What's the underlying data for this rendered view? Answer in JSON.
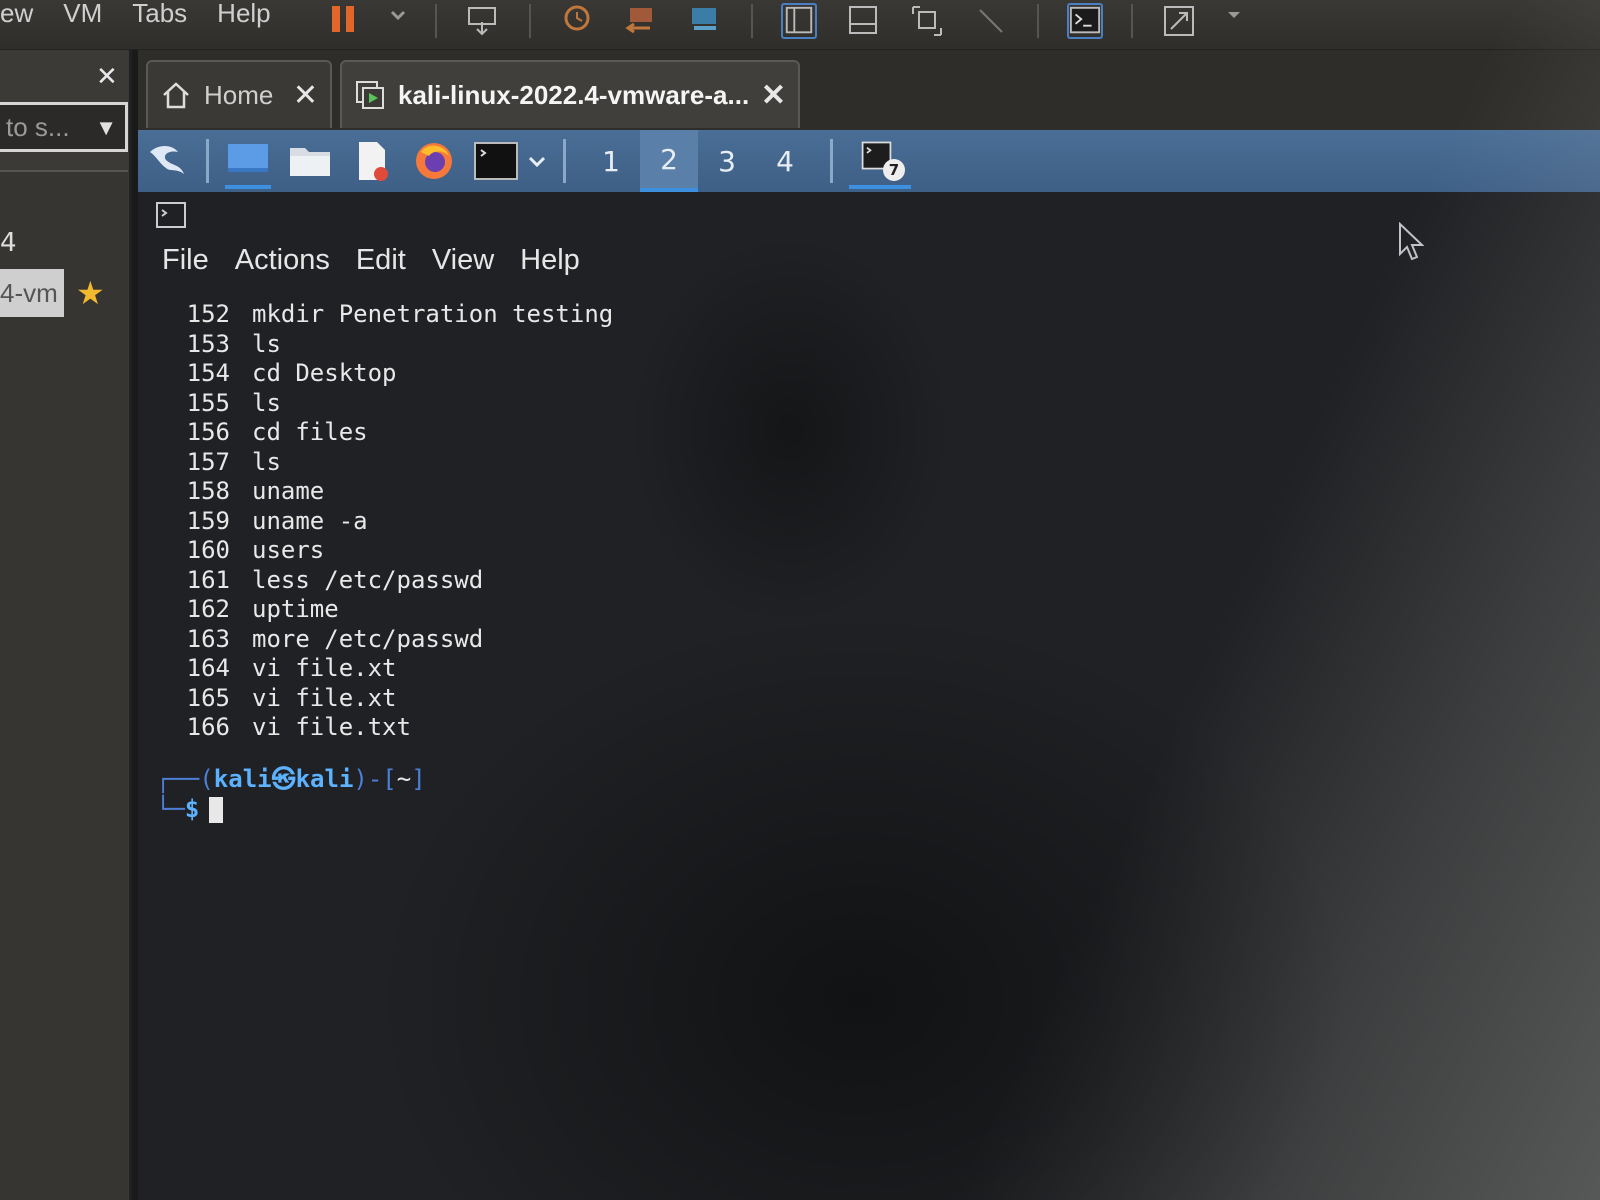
{
  "vmware": {
    "menu": [
      "ew",
      "VM",
      "Tabs",
      "Help"
    ]
  },
  "sidebar": {
    "search_value": "to s...",
    "tree_fragment": "4",
    "vm_item": "4-vm"
  },
  "tabs": [
    {
      "label": "Home"
    },
    {
      "label": "kali-linux-2022.4-vmware-a..."
    }
  ],
  "kali_panel": {
    "workspaces": [
      "1",
      "2",
      "3",
      "4"
    ],
    "current_workspace": "2",
    "badge": "7"
  },
  "terminal": {
    "menu": [
      "File",
      "Actions",
      "Edit",
      "View",
      "Help"
    ],
    "history": [
      {
        "num": "152",
        "cmd": "mkdir Penetration testing"
      },
      {
        "num": "153",
        "cmd": "ls"
      },
      {
        "num": "154",
        "cmd": "cd Desktop"
      },
      {
        "num": "155",
        "cmd": "ls"
      },
      {
        "num": "156",
        "cmd": "cd files"
      },
      {
        "num": "157",
        "cmd": "ls"
      },
      {
        "num": "158",
        "cmd": "uname"
      },
      {
        "num": "159",
        "cmd": "uname -a"
      },
      {
        "num": "160",
        "cmd": "users"
      },
      {
        "num": "161",
        "cmd": "less /etc/passwd"
      },
      {
        "num": "162",
        "cmd": "uptime"
      },
      {
        "num": "163",
        "cmd": "more /etc/passwd"
      },
      {
        "num": "164",
        "cmd": "vi file.xt"
      },
      {
        "num": "165",
        "cmd": "vi file.xt"
      },
      {
        "num": "166",
        "cmd": "vi file.txt"
      }
    ],
    "prompt": {
      "line1_prefix": "┌──(",
      "user": "kali㉿kali",
      "line1_suffix": ")-[",
      "dir": "~",
      "line1_end": "]",
      "line2_prefix": "└─",
      "dollar": "$"
    }
  },
  "colors": {
    "kali_panel": "#4a6e96",
    "terminal_bg": "#1f2124",
    "prompt_user": "#5db2ff",
    "star": "#f2b92e",
    "accent": "#3d8fe0"
  },
  "icons": [
    "pause-icon",
    "send-keys-icon",
    "snapshot-icon",
    "revert-icon",
    "manage-snapshots-icon",
    "library-view-icon",
    "thumbnail-icon",
    "full-screen-icon",
    "unity-icon",
    "console-icon",
    "stretch-icon",
    "home-icon",
    "vm-tab-icon",
    "kali-dragon-icon",
    "show-desktop-icon",
    "file-manager-icon",
    "text-editor-icon",
    "firefox-icon",
    "terminal-icon",
    "chevron-down-icon",
    "terminal-app-icon"
  ]
}
